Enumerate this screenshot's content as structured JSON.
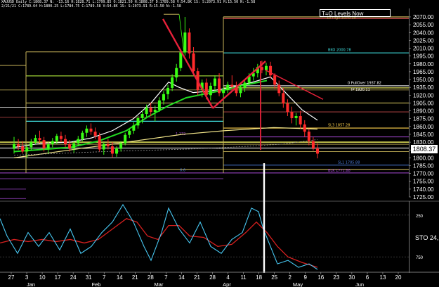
{
  "header": {
    "line1": "XAUUSD Daily C:1808.37 N: -13.16 H:1828.71 L:1799.85 O:1821.50 H:1808.37 D:1789.58 V:54.8K 1S: S:2073.91 R:15.50 N:-1.58",
    "line2": "2/21/21 C:1789.64 H:1800.25 L:1784.75 C:1789.58 V:54.8K 1S: S:2073.91 R:15.50 N:-1.58"
  },
  "title_box": "T=O Levels Now",
  "current_price_tag": "1808.37",
  "osc_label": "STO 24,",
  "price_axis": {
    "ticks": [
      "2070.00",
      "2055.00",
      "2040.00",
      "2025.00",
      "2010.00",
      "1995.00",
      "1980.00",
      "1965.00",
      "1950.00",
      "1935.00",
      "1920.00",
      "1905.00",
      "1890.00",
      "1875.00",
      "1860.00",
      "1845.00",
      "1830.00",
      "1815.00",
      "1800.00",
      "1785.00",
      "1770.00",
      "1755.00",
      "1740.00",
      "1725.00"
    ]
  },
  "osc_axis": {
    "ticks": [
      "250",
      "750"
    ]
  },
  "date_axis": {
    "day_ticks": [
      "27",
      "3",
      "10",
      "17",
      "24",
      "31",
      "7",
      "14",
      "21",
      "28",
      "7",
      "14",
      "21",
      "28",
      "4",
      "11",
      "18",
      "25",
      "2",
      "9",
      "16",
      "23",
      "30",
      "6",
      "13",
      "20"
    ],
    "months": [
      "Jan",
      "Feb",
      "Mar",
      "Apr",
      "May",
      "Jun"
    ]
  },
  "level_labels": {
    "lbl_2070": "10 High 2070.18",
    "lbl_2000": "BKO 2000.78",
    "lbl_pivot": "0 PullOver 1937.82",
    "lbl_ip": "IP 1920.11",
    "lbl_1857": "SL3 1857.28",
    "lbl_1760": "BLK 1771.88",
    "lbl_1785": "SL1 1785.88",
    "lbl_1272": "1.272",
    "lbl_cd": "6.6"
  },
  "colors": {
    "bull": "#39ff14",
    "bear": "#ff2b2b",
    "ma_white": "#ffffff",
    "ma_green": "#22dd22",
    "ma_yellow": "#f3e68a",
    "trend_red": "#e8213a",
    "osc_blue": "#47c6f0",
    "osc_red": "#d6201f"
  },
  "chart_data": {
    "type": "candlestick",
    "title": "",
    "x": [
      "Jan 11",
      "Jan 25",
      "Feb 8",
      "Feb 22",
      "Mar 3",
      "Mar 8",
      "Mar 15",
      "Mar 22",
      "Apr 4",
      "Apr 18",
      "Apr 25",
      "May 2",
      "May 9",
      "May 13"
    ],
    "close": [
      1845,
      1850,
      1840,
      1895,
      1960,
      2040,
      1935,
      1920,
      1925,
      1960,
      1905,
      1860,
      1850,
      1808.37
    ],
    "ylim": [
      1715,
      2085
    ],
    "levels": [
      2070.18,
      2000.78,
      1937.82,
      1920.11,
      1857.28,
      1785.88,
      1771.88
    ]
  }
}
